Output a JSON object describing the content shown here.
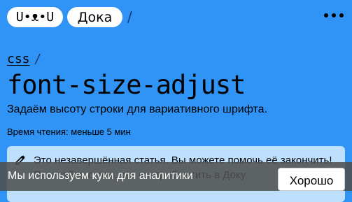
{
  "header": {
    "logo_text": "U•ᴥ•U",
    "site_name": "Дока",
    "separator": "/",
    "menu_icon": "more-dots-icon"
  },
  "breadcrumb": {
    "section": "css",
    "separator": "/"
  },
  "article": {
    "title": "font-size-adjust",
    "description": "Задаём высоту строки для вариативного шрифта.",
    "reading_time": "Время чтения: меньше 5 мин"
  },
  "callout": {
    "icon": "pencil-icon",
    "text": "Это незавершённая статья. Вы можете помочь её закончить! Почитайте о том, как контрибьютить в Доку."
  },
  "cookie_banner": {
    "message": "Мы используем куки для аналитики",
    "button_label": "Хорошо"
  },
  "colors": {
    "background": "#2f94f5",
    "callout_bg": "#bfe0fd",
    "banner_bg": "#505050"
  }
}
